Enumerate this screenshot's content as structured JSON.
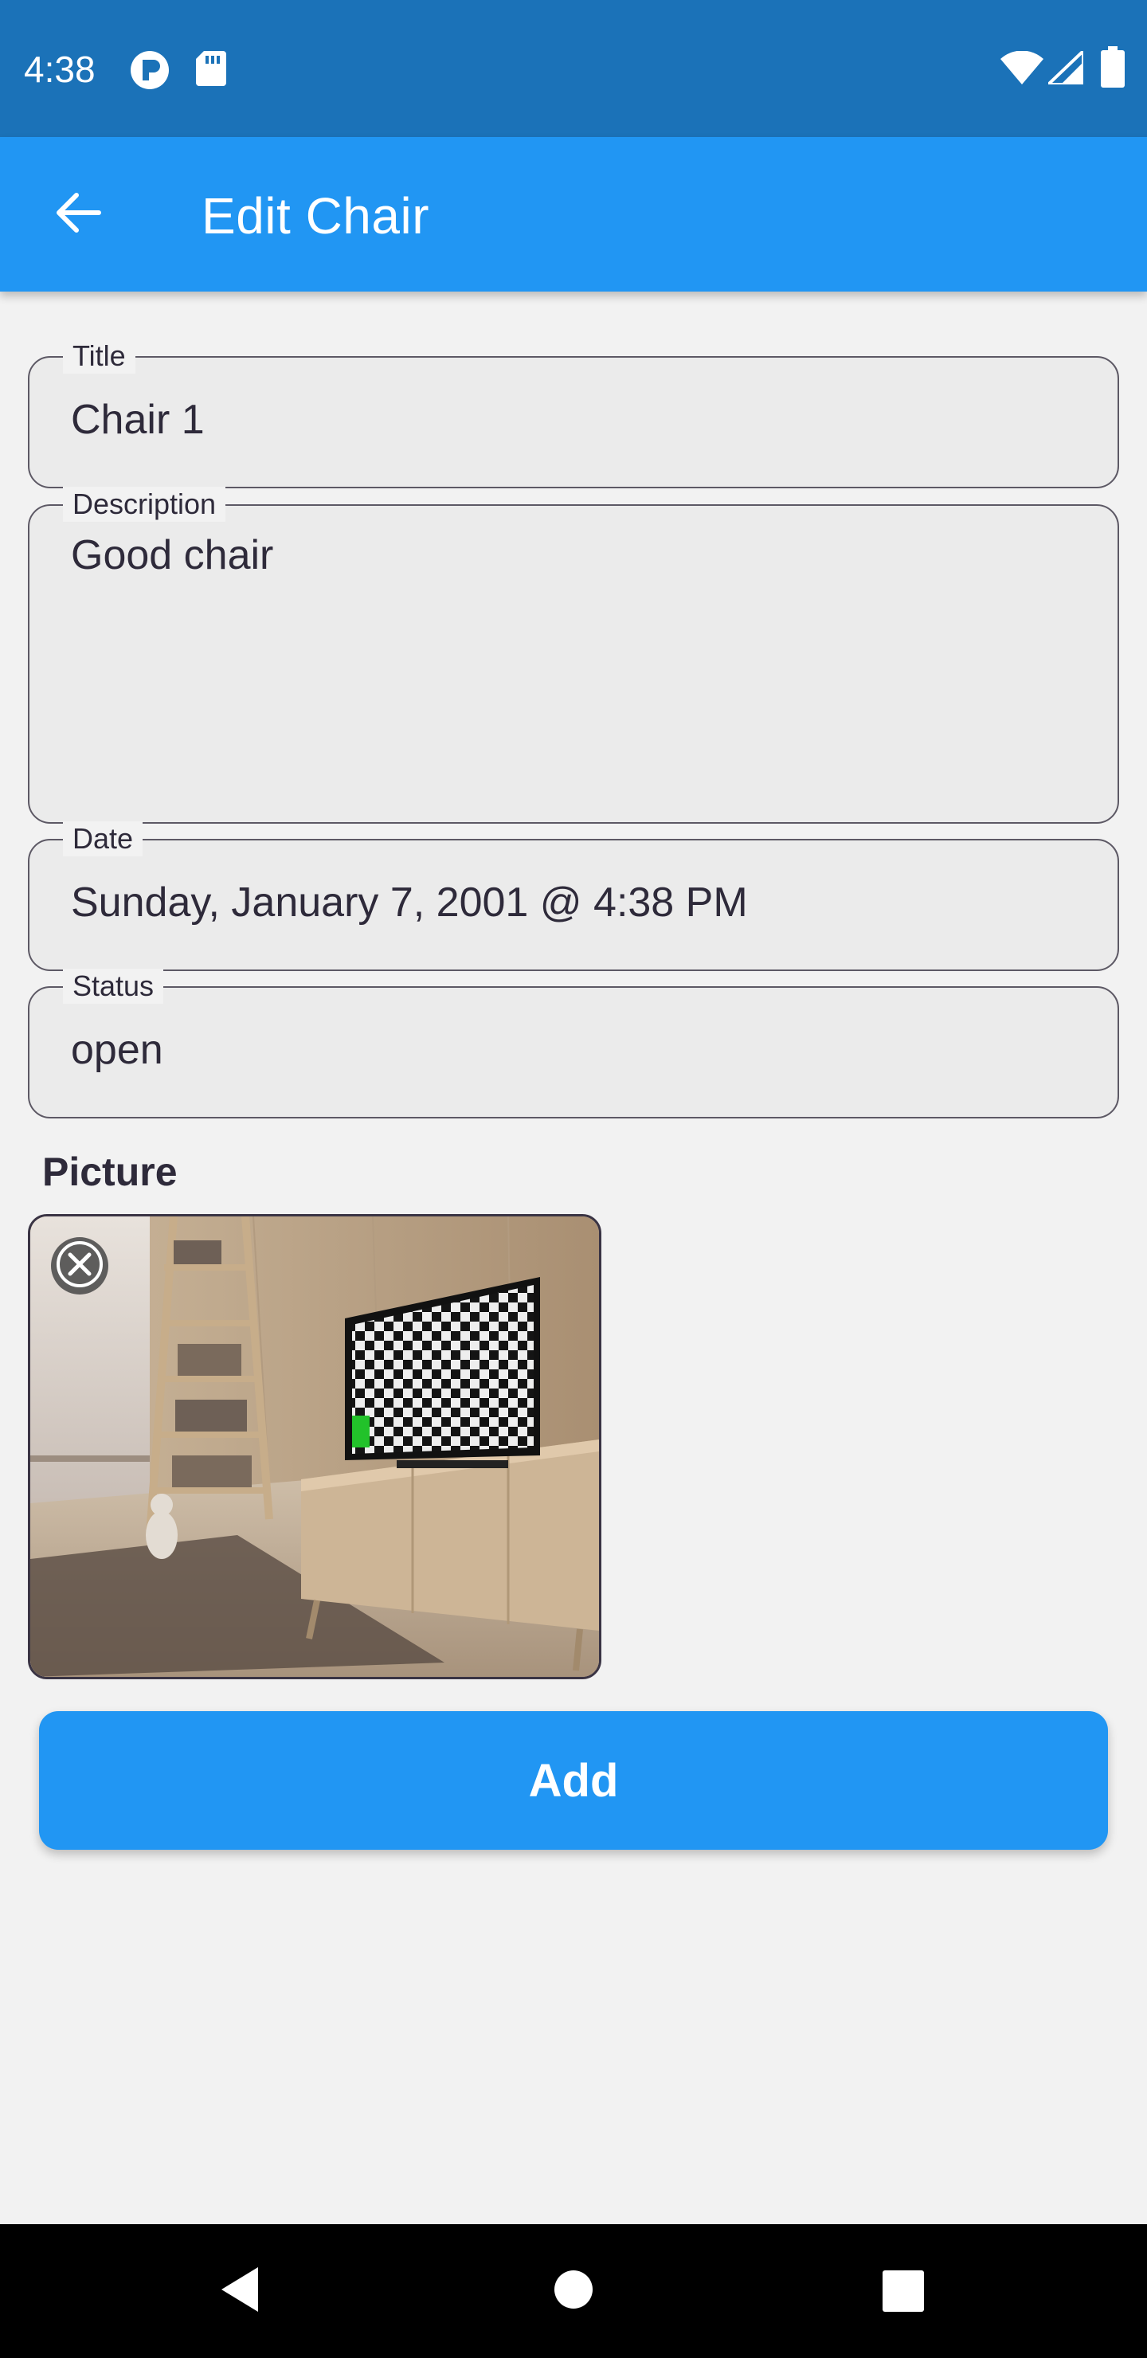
{
  "status_bar": {
    "time": "4:38",
    "left_icons": [
      "p-badge-icon",
      "sd-card-icon"
    ],
    "right_icons": [
      "wifi-icon",
      "signal-icon",
      "battery-icon"
    ]
  },
  "app_bar": {
    "back_icon": "arrow-back-icon",
    "title": "Edit Chair",
    "color": "#2196f3"
  },
  "form": {
    "title": {
      "label": "Title",
      "value": "Chair 1"
    },
    "description": {
      "label": "Description",
      "value": "Good chair"
    },
    "date": {
      "label": "Date",
      "value": "Sunday, January 7, 2001 @ 4:38 PM"
    },
    "status": {
      "label": "Status",
      "value": "open"
    }
  },
  "picture": {
    "heading": "Picture",
    "remove_icon": "close-icon"
  },
  "add_button": {
    "label": "Add",
    "color": "#2196f3"
  },
  "nav_bar": {
    "icons": [
      "nav-back-icon",
      "nav-home-icon",
      "nav-recents-icon"
    ]
  }
}
